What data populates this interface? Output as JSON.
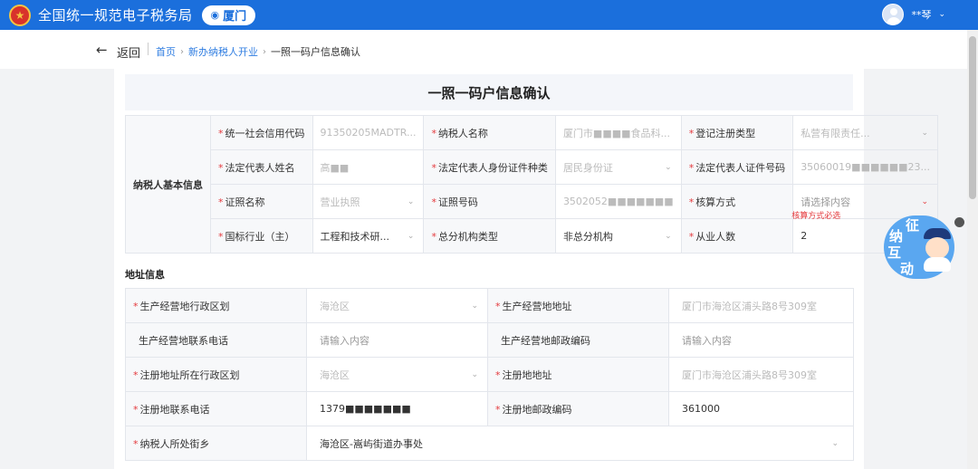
{
  "header": {
    "app_title": "全国统一规范电子税务局",
    "region": "厦门",
    "user_name": "**琴",
    "user_caret": "⌄"
  },
  "nav": {
    "back_label": "返回",
    "breadcrumb": [
      "首页",
      "新办纳税人开业",
      "一照一码户信息确认"
    ],
    "crumb_separator": "›"
  },
  "page_title": "一照一码户信息确认",
  "basic_section": {
    "title": "纳税人基本信息",
    "rows": [
      [
        {
          "label": "统一社会信用代码",
          "required": true,
          "value": "91350205MADTR..."
        },
        {
          "label": "纳税人名称",
          "required": true,
          "value": "厦门市■■■■食品科..."
        },
        {
          "label": "登记注册类型",
          "required": true,
          "value": "私营有限责任..."
        }
      ],
      [
        {
          "label": "法定代表人姓名",
          "required": true,
          "value": "高■■"
        },
        {
          "label": "法定代表人身份证件种类",
          "required": true,
          "value": "居民身份证"
        },
        {
          "label": "法定代表人证件号码",
          "required": true,
          "value": "35060019■■■■■■23..."
        }
      ],
      [
        {
          "label": "证照名称",
          "required": true,
          "value": "营业执照"
        },
        {
          "label": "证照号码",
          "required": true,
          "value": "3502052■■■■■■■"
        },
        {
          "label": "核算方式",
          "required": true,
          "value": "请选择内容",
          "error": "核算方式必选"
        }
      ],
      [
        {
          "label": "国标行业（主）",
          "required": true,
          "value": "工程和技术研..."
        },
        {
          "label": "总分机构类型",
          "required": true,
          "value": "非总分机构"
        },
        {
          "label": "从业人数",
          "required": true,
          "value": "2"
        }
      ]
    ]
  },
  "address_section": {
    "title": "地址信息",
    "rows": [
      [
        {
          "label": "生产经营地行政区划",
          "required": true,
          "value": "海沧区"
        },
        {
          "label": "生产经营地地址",
          "required": true,
          "value": "厦门市海沧区浦头路8号309室"
        }
      ],
      [
        {
          "label": "生产经营地联系电话",
          "required": false,
          "value": "请输入内容"
        },
        {
          "label": "生产经营地邮政编码",
          "required": false,
          "value": "请输入内容"
        }
      ],
      [
        {
          "label": "注册地址所在行政区划",
          "required": true,
          "value": "海沧区"
        },
        {
          "label": "注册地地址",
          "required": true,
          "value": "厦门市海沧区浦头路8号309室"
        }
      ],
      [
        {
          "label": "注册地联系电话",
          "required": true,
          "value": "1379■■■■■■■"
        },
        {
          "label": "注册地邮政编码",
          "required": true,
          "value": "361000"
        }
      ]
    ],
    "street_row": {
      "label": "纳税人所处街乡",
      "required": true,
      "value": "海沧区-嵩屿街道办事处"
    }
  },
  "float_widget": {
    "chars": [
      "征",
      "纳",
      "互",
      "动"
    ]
  },
  "icons": {
    "emblem": "tax-emblem-icon",
    "pin": "location-pin-icon",
    "back": "back-arrow-icon",
    "chevron": "chevron-down-icon"
  },
  "colors": {
    "topbar": "#1b6fdc",
    "link": "#2f7de1",
    "required": "#e4393c"
  }
}
